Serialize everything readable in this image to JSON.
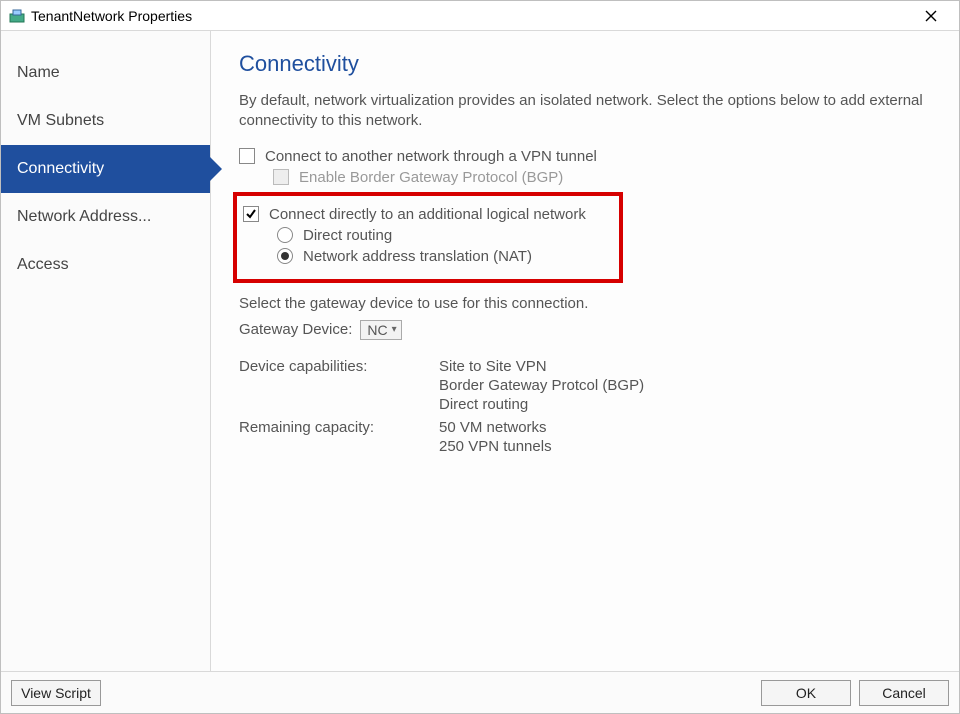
{
  "window": {
    "title": "TenantNetwork Properties"
  },
  "sidebar": {
    "items": [
      {
        "label": "Name"
      },
      {
        "label": "VM Subnets"
      },
      {
        "label": "Connectivity"
      },
      {
        "label": "Network Address..."
      },
      {
        "label": "Access"
      }
    ],
    "selected_index": 2
  },
  "page": {
    "heading": "Connectivity",
    "description": "By default, network virtualization provides an isolated network. Select the options below to add external connectivity to this network.",
    "opt_vpn": {
      "label": "Connect to another network through a VPN tunnel",
      "checked": false
    },
    "opt_bgp": {
      "label": "Enable Border Gateway Protocol (BGP)",
      "checked": false,
      "disabled": true
    },
    "opt_direct": {
      "label": "Connect directly to an additional logical network",
      "checked": true
    },
    "radio_direct_routing": {
      "label": "Direct routing",
      "selected": false
    },
    "radio_nat": {
      "label": "Network address translation (NAT)",
      "selected": true
    },
    "gateway_instruction": "Select the gateway device to use for this connection.",
    "gateway_label": "Gateway Device:",
    "gateway_value": "NC",
    "device_caps_label": "Device capabilities:",
    "device_caps": [
      "Site to Site VPN",
      "Border Gateway Protcol (BGP)",
      "Direct routing"
    ],
    "remaining_label": "Remaining capacity:",
    "remaining": [
      "50 VM networks",
      "250 VPN tunnels"
    ]
  },
  "footer": {
    "view_script": "View Script",
    "ok": "OK",
    "cancel": "Cancel"
  }
}
